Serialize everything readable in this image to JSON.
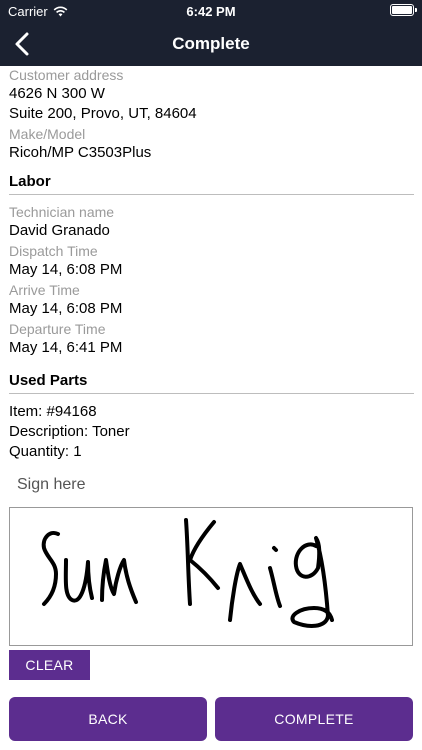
{
  "status_bar": {
    "carrier": "Carrier",
    "time": "6:42 PM"
  },
  "nav": {
    "title": "Complete",
    "back_icon": "chevron-left-icon"
  },
  "customer": {
    "address_label": "Customer address",
    "address_line1": "4626 N 300 W",
    "address_line2": "Suite 200, Provo, UT, 84604",
    "make_model_label": "Make/Model",
    "make_model": "Ricoh/MP C3503Plus"
  },
  "labor": {
    "title": "Labor",
    "technician_label": "Technician name",
    "technician": "David Granado",
    "dispatch_label": "Dispatch Time",
    "dispatch": "May 14, 6:08 PM",
    "arrive_label": "Arrive Time",
    "arrive": "May 14, 6:08 PM",
    "departure_label": "Departure Time",
    "departure": "May 14, 6:41 PM"
  },
  "used_parts": {
    "title": "Used Parts",
    "item": "Item: #94168",
    "description": "Description: Toner",
    "quantity": "Quantity: 1"
  },
  "signature": {
    "prompt": "Sign here",
    "clear_label": "CLEAR"
  },
  "actions": {
    "back_label": "BACK",
    "complete_label": "COMPLETE"
  },
  "colors": {
    "nav_bg": "#1b2130",
    "accent": "#5c2d8f"
  }
}
